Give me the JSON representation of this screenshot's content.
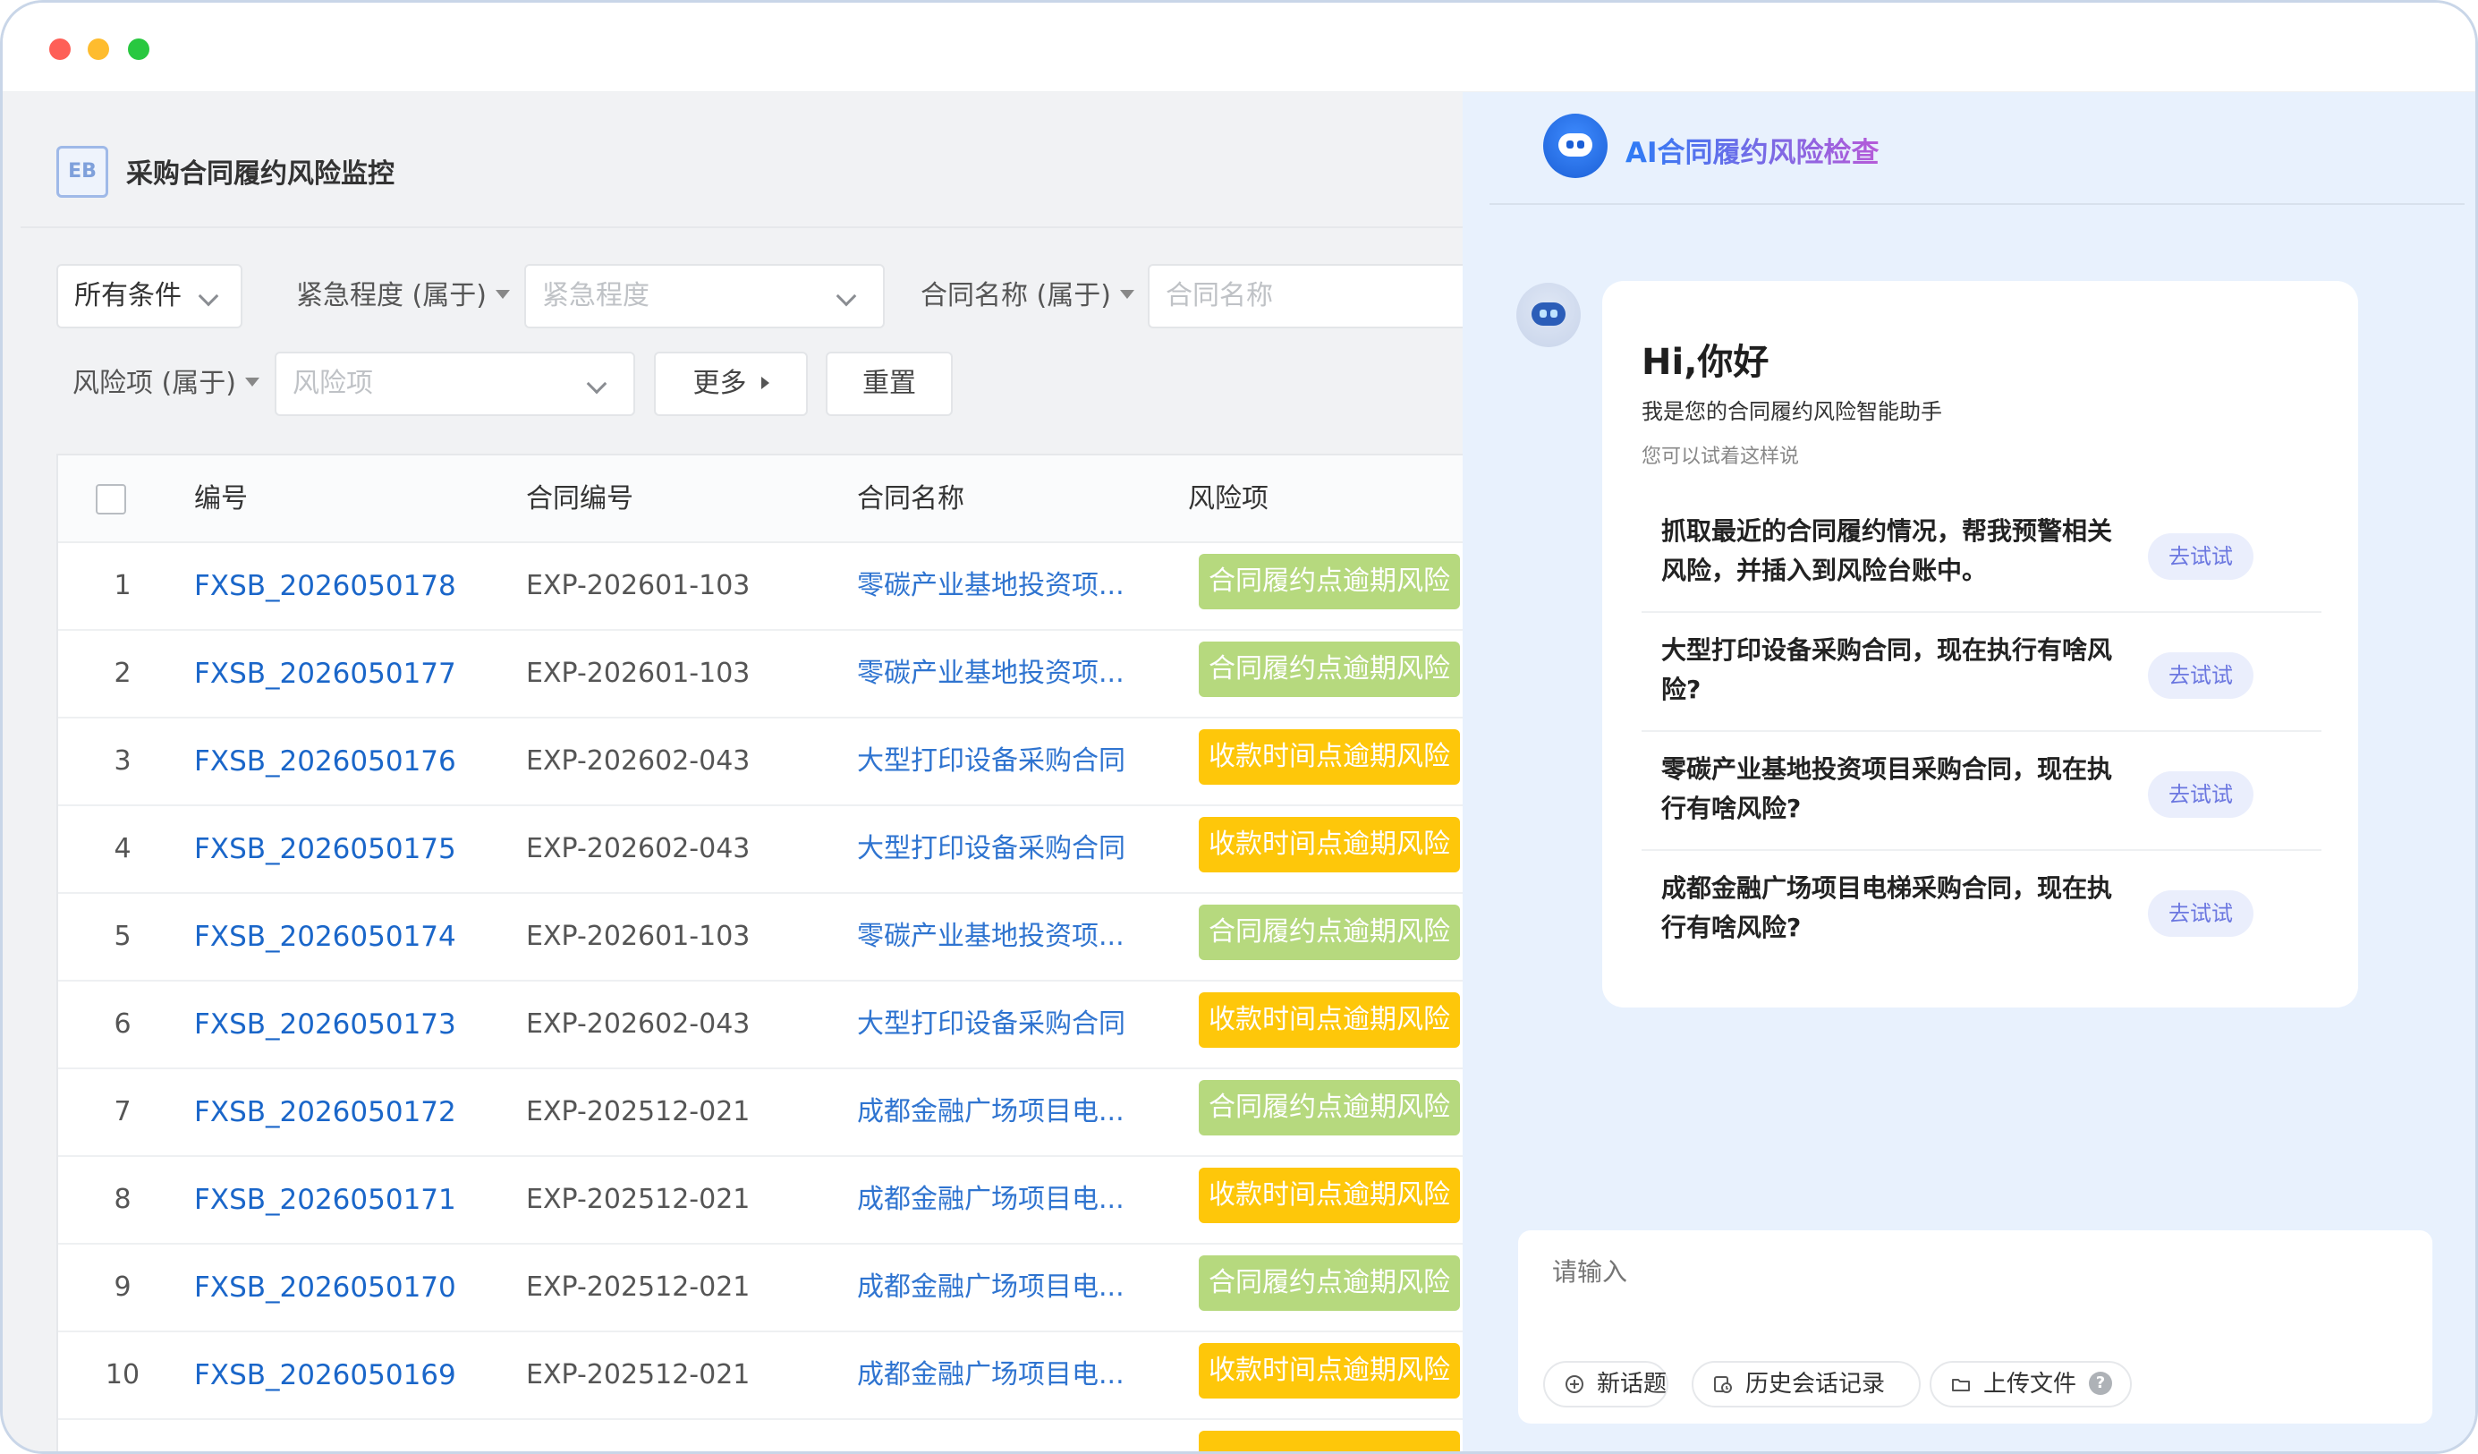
{
  "app": {
    "logo_text": "EB",
    "title": "采购合同履约风险监控"
  },
  "filters": {
    "all_conditions": "所有条件",
    "urgency_label": "紧急程度 (属于)",
    "urgency_placeholder": "紧急程度",
    "contract_name_label": "合同名称 (属于)",
    "contract_name_placeholder": "合同名称",
    "risk_item_label": "风险项 (属于)",
    "risk_item_placeholder": "风险项",
    "more_button": "更多",
    "reset_button": "重置"
  },
  "table": {
    "columns": [
      "编号",
      "合同编号",
      "合同名称",
      "风险项"
    ],
    "rows": [
      {
        "index": "1",
        "no": "FXSB_2026050178",
        "contract_no": "EXP-202601-103",
        "contract_name": "零碳产业基地投资项...",
        "risk": "合同履约点逾期风险",
        "risk_color": "green"
      },
      {
        "index": "2",
        "no": "FXSB_2026050177",
        "contract_no": "EXP-202601-103",
        "contract_name": "零碳产业基地投资项...",
        "risk": "合同履约点逾期风险",
        "risk_color": "green"
      },
      {
        "index": "3",
        "no": "FXSB_2026050176",
        "contract_no": "EXP-202602-043",
        "contract_name": "大型打印设备采购合同",
        "risk": "收款时间点逾期风险",
        "risk_color": "yellow"
      },
      {
        "index": "4",
        "no": "FXSB_2026050175",
        "contract_no": "EXP-202602-043",
        "contract_name": "大型打印设备采购合同",
        "risk": "收款时间点逾期风险",
        "risk_color": "yellow"
      },
      {
        "index": "5",
        "no": "FXSB_2026050174",
        "contract_no": "EXP-202601-103",
        "contract_name": "零碳产业基地投资项...",
        "risk": "合同履约点逾期风险",
        "risk_color": "green"
      },
      {
        "index": "6",
        "no": "FXSB_2026050173",
        "contract_no": "EXP-202602-043",
        "contract_name": "大型打印设备采购合同",
        "risk": "收款时间点逾期风险",
        "risk_color": "yellow"
      },
      {
        "index": "7",
        "no": "FXSB_2026050172",
        "contract_no": "EXP-202512-021",
        "contract_name": "成都金融广场项目电...",
        "risk": "合同履约点逾期风险",
        "risk_color": "green"
      },
      {
        "index": "8",
        "no": "FXSB_2026050171",
        "contract_no": "EXP-202512-021",
        "contract_name": "成都金融广场项目电...",
        "risk": "收款时间点逾期风险",
        "risk_color": "yellow"
      },
      {
        "index": "9",
        "no": "FXSB_2026050170",
        "contract_no": "EXP-202512-021",
        "contract_name": "成都金融广场项目电...",
        "risk": "合同履约点逾期风险",
        "risk_color": "green"
      },
      {
        "index": "10",
        "no": "FXSB_2026050169",
        "contract_no": "EXP-202512-021",
        "contract_name": "成都金融广场项目电...",
        "risk": "收款时间点逾期风险",
        "risk_color": "yellow"
      }
    ]
  },
  "ai_panel": {
    "title": "AI合同履约风险检查",
    "greeting": "Hi,你好",
    "intro": "我是您的合同履约风险智能助手",
    "hint": "您可以试着这样说",
    "suggestions": [
      {
        "text": "抓取最近的合同履约情况，帮我预警相关风险，并插入到风险台账中。",
        "button": "去试试"
      },
      {
        "text": "大型打印设备采购合同，现在执行有啥风险?",
        "button": "去试试"
      },
      {
        "text": "零碳产业基地投资项目采购合同，现在执行有啥风险?",
        "button": "去试试"
      },
      {
        "text": "成都金融广场项目电梯采购合同，现在执行有啥风险?",
        "button": "去试试"
      }
    ],
    "input_placeholder": "请输入",
    "new_topic": "新话题",
    "history": "历史会话记录",
    "upload": "上传文件",
    "help_icon_text": "?"
  },
  "colors": {
    "tag_green": "#b6d97e",
    "tag_yellow": "#fec70a",
    "link_blue": "#1a66c9",
    "ai_accent": "#2d7cf6"
  }
}
